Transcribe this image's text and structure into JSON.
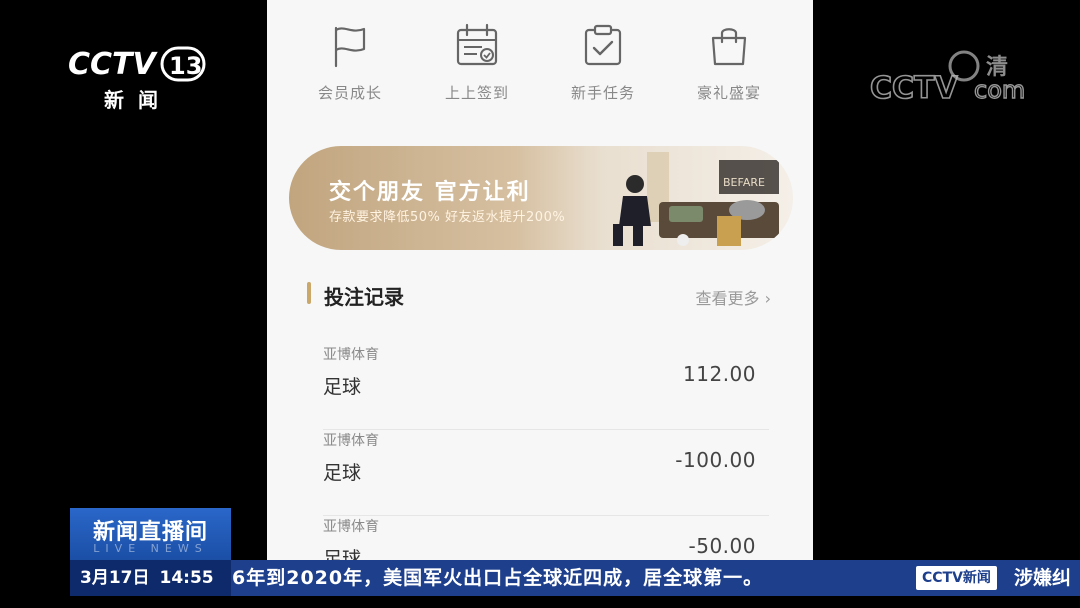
{
  "nav": {
    "items": [
      {
        "label": "会员成长",
        "icon": "flag-icon"
      },
      {
        "label": "上上签到",
        "icon": "calendar-icon"
      },
      {
        "label": "新手任务",
        "icon": "clipboard-check-icon"
      },
      {
        "label": "豪礼盛宴",
        "icon": "shopping-bag-icon"
      }
    ]
  },
  "banner": {
    "title": "交个朋友 官方让利",
    "subtitle": "存款要求降低50% 好友返水提升200%",
    "art_label": "BEFARE"
  },
  "records": {
    "title": "投注记录",
    "more": "查看更多 ›",
    "items": [
      {
        "platform": "亚博体育",
        "sport": "足球",
        "amount": "112.00"
      },
      {
        "platform": "亚博体育",
        "sport": "足球",
        "amount": "-100.00"
      },
      {
        "platform": "亚博体育",
        "sport": "足球",
        "amount": "-50.00"
      }
    ]
  },
  "broadcast": {
    "channel_news": "新闻",
    "program_title": "新闻直播间",
    "program_sub": "LIVE NEWS",
    "date": "3月17日",
    "time": "14:55",
    "ticker": "6年到2020年，美国军火出口占全球近四成，居全球第一。",
    "ticker_logo": "CCTV新闻",
    "ticker_tail": "涉嫌纠"
  },
  "colors": {
    "accent_gold": "#c9a86a",
    "ticker_blue": "#1d3f8c",
    "program_blue": "#2a67c9"
  }
}
